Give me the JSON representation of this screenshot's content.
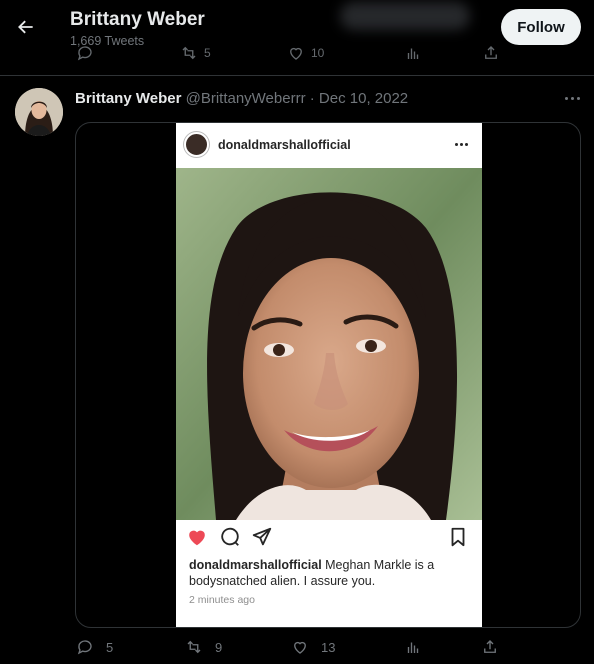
{
  "header": {
    "title": "Brittany Weber",
    "subtitle": "1,669 Tweets",
    "follow_label": "Follow",
    "ghost_counts": {
      "retweets": "5",
      "likes": "10"
    }
  },
  "tweet": {
    "name": "Brittany Weber",
    "handle": "@BrittanyWeberrr",
    "separator": "·",
    "date": "Dec 10, 2022",
    "media": {
      "username": "donaldmarshallofficial",
      "caption_user": "donaldmarshallofficial",
      "caption_text": " Meghan Markle is a bodysnatched alien.  I assure you.",
      "time": "2 minutes ago"
    },
    "actions": {
      "replies": "5",
      "retweets": "9",
      "likes": "13"
    }
  },
  "colors": {
    "background": "#000000",
    "text_primary": "#e7e9ea",
    "text_secondary": "#71767b",
    "border": "#2f3336",
    "follow_bg": "#eff3f4",
    "heart_red": "#ed4956"
  },
  "icons": [
    "back-arrow-icon",
    "more-icon",
    "reply-icon",
    "retweet-icon",
    "like-icon",
    "views-icon",
    "share-icon",
    "heart-icon",
    "comment-icon",
    "send-icon",
    "bookmark-icon"
  ]
}
